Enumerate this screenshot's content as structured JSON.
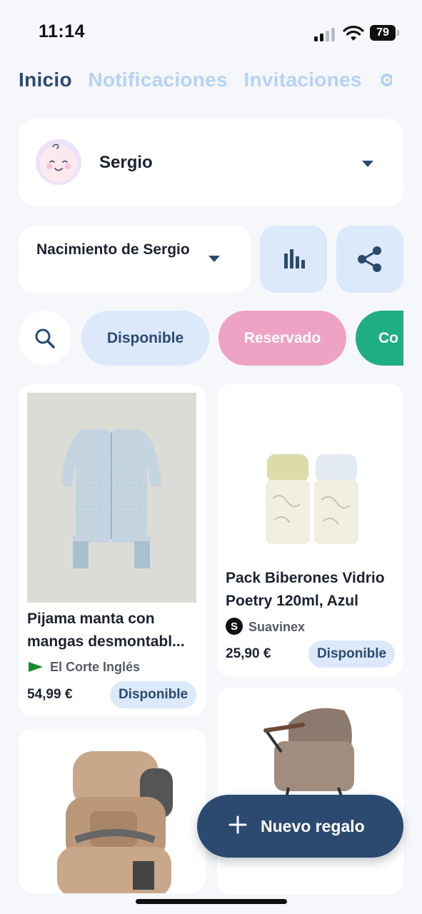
{
  "status_bar": {
    "time": "11:14",
    "battery": "79"
  },
  "tabs": [
    {
      "label": "Inicio",
      "active": true
    },
    {
      "label": "Notificaciones",
      "active": false
    },
    {
      "label": "Invitaciones",
      "active": false
    }
  ],
  "profile": {
    "name": "Sergio",
    "avatar_icon": "baby-face-icon"
  },
  "event": {
    "label": "Nacimiento de Sergio"
  },
  "actions": {
    "stats_icon": "bar-chart-icon",
    "share_icon": "share-icon"
  },
  "filters": {
    "search_icon": "search-icon",
    "chips": [
      {
        "label": "Disponible",
        "color": "#dbe9fb"
      },
      {
        "label": "Reservado",
        "color": "#eea3c4"
      },
      {
        "label": "Co",
        "color": "#1fad84"
      }
    ]
  },
  "products": [
    {
      "title_line1": "Pijama manta con",
      "title_line2": "mangas desmontabl...",
      "store": "El Corte Inglés",
      "price": "54,99 €",
      "status": "Disponible"
    },
    {
      "title_line1": "Pack Biberones Vidrio",
      "title_line2": "Poetry 120ml, Azul",
      "store": "Suavinex",
      "store_logo_letter": "S",
      "price": "25,90 €",
      "status": "Disponible"
    },
    {
      "image": "car-seat"
    },
    {
      "image": "stroller"
    }
  ],
  "fab": {
    "label": "Nuevo regalo",
    "icon": "plus-icon"
  },
  "colors": {
    "primary": "#2c4a70",
    "light_blue": "#dbe9fb",
    "reserved_pink": "#eea3c4",
    "bought_green": "#1fad84"
  }
}
